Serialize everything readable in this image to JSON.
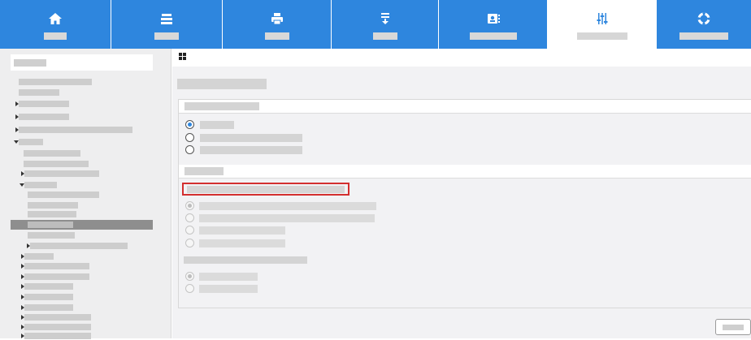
{
  "top_nav": {
    "tabs": [
      {
        "name": "home",
        "icon": "home-icon",
        "label": "",
        "active": false
      },
      {
        "name": "jobs",
        "icon": "tray-icon",
        "label": "",
        "active": false
      },
      {
        "name": "print",
        "icon": "printer-icon",
        "label": "",
        "active": false
      },
      {
        "name": "scan",
        "icon": "download-icon",
        "label": "",
        "active": false
      },
      {
        "name": "address-book",
        "icon": "contacts-icon",
        "label": "",
        "active": false
      },
      {
        "name": "settings",
        "icon": "sliders-icon",
        "label": "",
        "active": true
      },
      {
        "name": "support",
        "icon": "lifebuoy-icon",
        "label": "",
        "active": false
      }
    ]
  },
  "sidebar": {
    "search_placeholder": "",
    "items": [
      "",
      "",
      "",
      "",
      "",
      "",
      "",
      "",
      "",
      "",
      "",
      "",
      "",
      "",
      "",
      "",
      "",
      "",
      "",
      "",
      "",
      "",
      "",
      "",
      ""
    ],
    "selected_item": ""
  },
  "main": {
    "title": "",
    "section1": {
      "heading": "",
      "options": [
        "",
        "",
        ""
      ],
      "selected": 0
    },
    "section2": {
      "heading": "",
      "highlighted_label": "",
      "options": [
        "",
        "",
        "",
        ""
      ],
      "subheading": "",
      "sub_options": [
        "",
        ""
      ]
    },
    "button_label": ""
  },
  "colors": {
    "accent": "#2e86de",
    "highlight_border": "#d32f2f",
    "selected_row": "#8e8e8e"
  }
}
